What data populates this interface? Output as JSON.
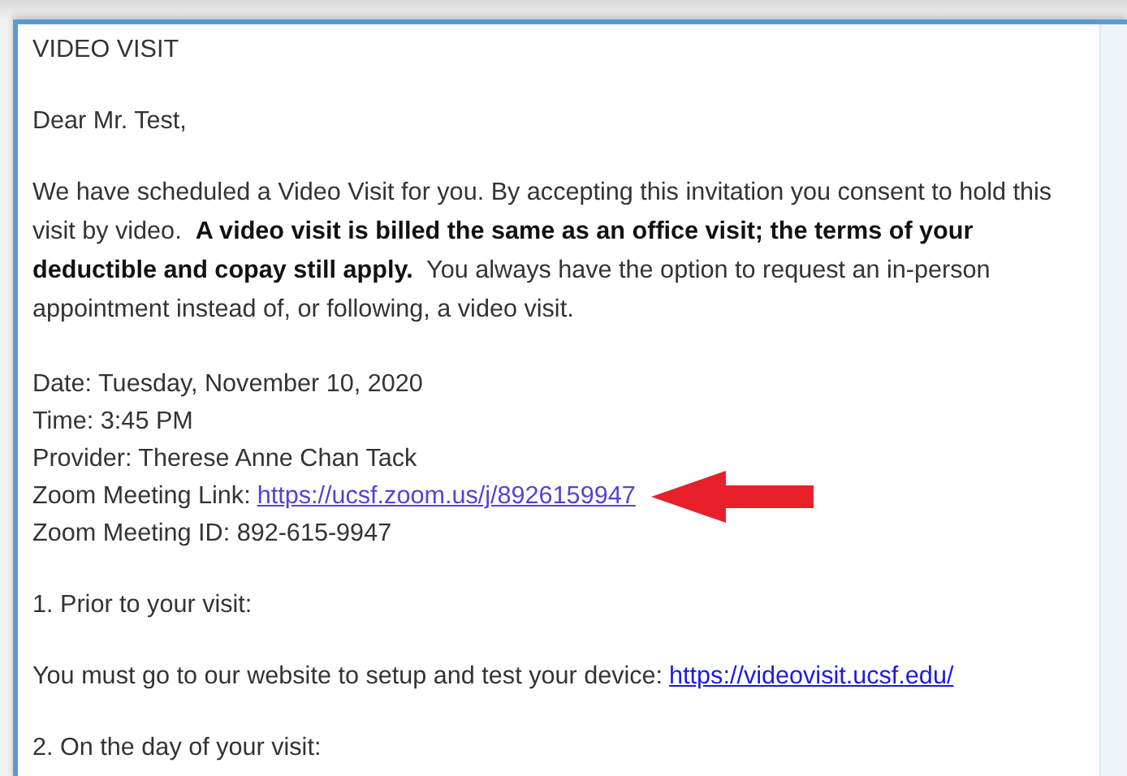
{
  "message": {
    "blocks": [
      {
        "kind": "text",
        "text": "VIDEO VISIT"
      },
      {
        "kind": "text",
        "text": "Dear Mr. Test,"
      },
      {
        "kind": "rich",
        "text": "We have scheduled a Video Visit for you. By accepting this invitation you consent to hold this visit by video.  **A video visit is billed the same as an office visit; the terms of your deductible and copay still apply.**  You always have the option to request an in-person appointment instead of, or following, a video visit."
      },
      {
        "kind": "lines",
        "lines": [
          {
            "text": "Date: Tuesday, November 10, 2020"
          },
          {
            "text": "Time: 3:45 PM"
          },
          {
            "text": "Provider: Therese Anne Chan Tack"
          },
          {
            "text": "Zoom Meeting Link:",
            "link": "https://ucsf.zoom.us/j/8926159947",
            "visited": true,
            "pointed": true
          },
          {
            "text": "Zoom Meeting ID: 892-615-9947"
          }
        ]
      },
      {
        "kind": "text",
        "text": "1. Prior to your visit:"
      },
      {
        "kind": "lines",
        "lines": [
          {
            "text": "You must go to our website to setup and test your device:",
            "link": "https://videovisit.ucsf.edu/",
            "visited": false,
            "pointed": false
          }
        ]
      },
      {
        "kind": "text",
        "text": "2. On the day of your visit:"
      }
    ]
  }
}
